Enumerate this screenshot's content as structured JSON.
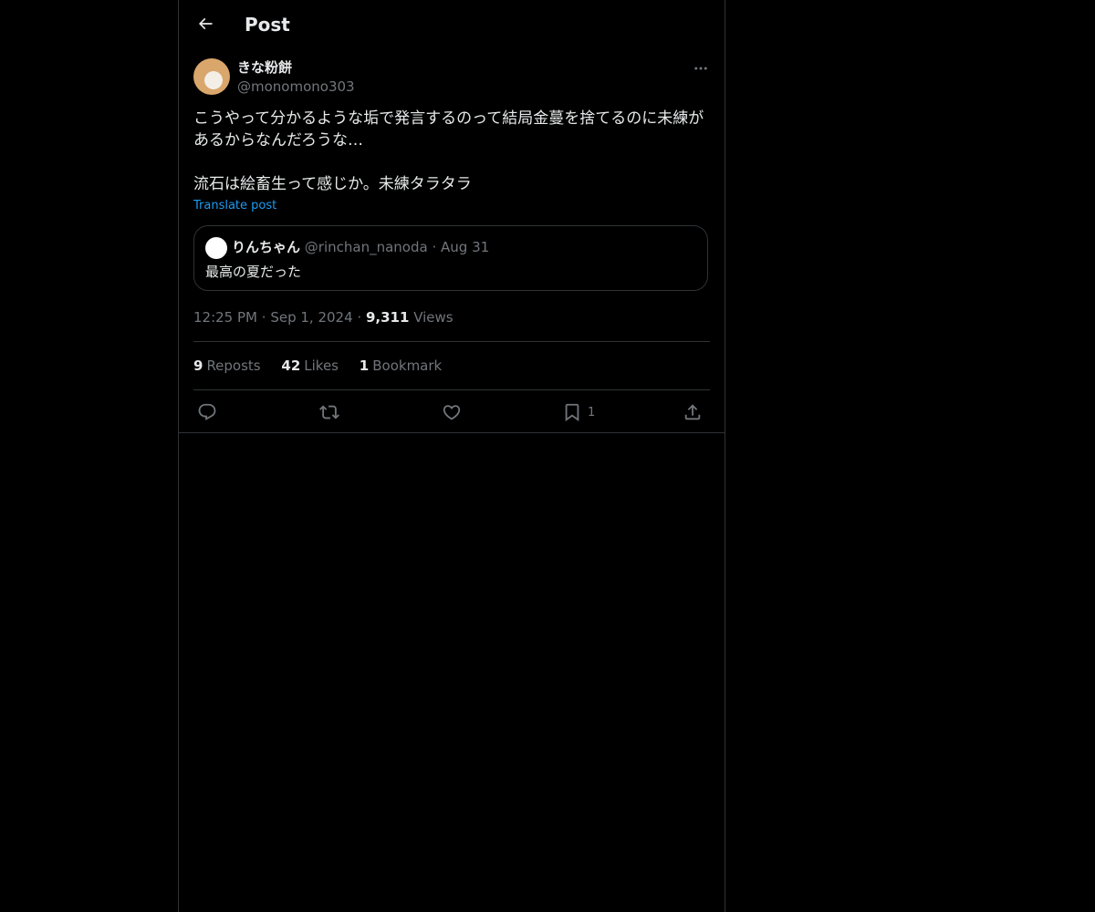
{
  "header": {
    "title": "Post",
    "back_icon": "arrow-left-icon"
  },
  "author": {
    "display_name": "きな粉餅",
    "handle": "@monomono303"
  },
  "post": {
    "text": "こうやって分かるような垢で発言するのって結局金蔓を捨てるのに未練があるからなんだろうな…\n\n流石は絵畜生って感じか。未練タラタラ",
    "translate_label": "Translate post"
  },
  "quote": {
    "name": "りんちゃん",
    "handle": "@rinchan_nanoda",
    "dot": "·",
    "date": "Aug 31",
    "text": "最高の夏だった"
  },
  "meta": {
    "time": "12:25 PM",
    "sep": "·",
    "date": "Sep 1, 2024",
    "views_count": "9,311",
    "views_label": "Views"
  },
  "stats": {
    "reposts_count": "9",
    "reposts_label": "Reposts",
    "likes_count": "42",
    "likes_label": "Likes",
    "bookmarks_count": "1",
    "bookmarks_label": "Bookmark"
  },
  "actions": {
    "bookmark_count": "1"
  },
  "colors": {
    "background": "#000000",
    "text": "#e7e9ea",
    "muted": "#71767b",
    "link": "#1d9bf0",
    "border": "#2f3336"
  }
}
